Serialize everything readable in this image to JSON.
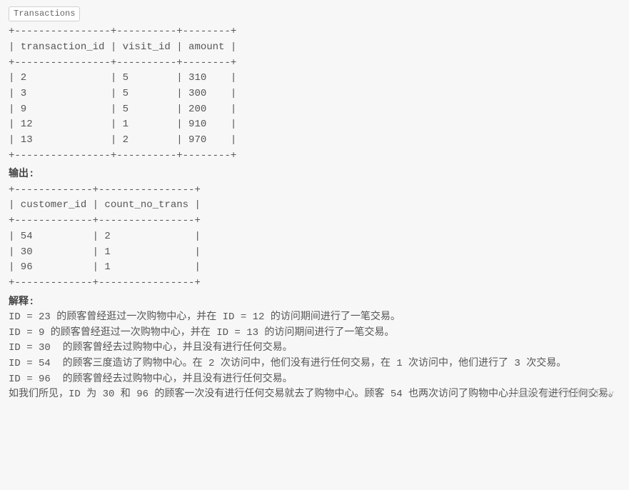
{
  "table1": {
    "label": "Transactions",
    "ascii": "+----------------+----------+--------+\n| transaction_id | visit_id | amount |\n+----------------+----------+--------+\n| 2              | 5        | 310    |\n| 3              | 5        | 300    |\n| 9              | 5        | 200    |\n| 12             | 1        | 910    |\n| 13             | 2        | 970    |\n+----------------+----------+--------+"
  },
  "output_label": "输出:",
  "table2": {
    "ascii": "+-------------+----------------+\n| customer_id | count_no_trans |\n+-------------+----------------+\n| 54          | 2              |\n| 30          | 1              |\n| 96          | 1              |\n+-------------+----------------+"
  },
  "explain_label": "解释:",
  "explain_lines": [
    "ID = 23 的顾客曾经逛过一次购物中心，并在 ID = 12 的访问期间进行了一笔交易。",
    "ID = 9 的顾客曾经逛过一次购物中心，并在 ID = 13 的访问期间进行了一笔交易。",
    "ID = 30  的顾客曾经去过购物中心，并且没有进行任何交易。",
    "ID = 54  的顾客三度造访了购物中心。在 2 次访问中，他们没有进行任何交易，在 1 次访问中，他们进行了 3 次交易。",
    "ID = 96  的顾客曾经去过购物中心，并且没有进行任何交易。",
    "如我们所见，ID 为 30 和 96 的顾客一次没有进行任何交易就去了购物中心。顾客 54 也两次访问了购物中心并且没有进行任何交易。"
  ],
  "watermark": "CSDN @CV工程师丁Sir"
}
